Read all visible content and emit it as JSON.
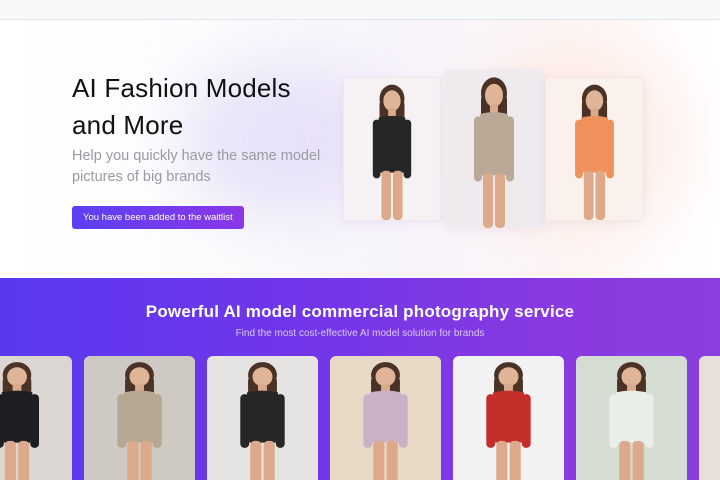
{
  "hero": {
    "title": "AI Fashion Models and More",
    "subtitle": "Help you quickly have the same model pictures of big brands",
    "waitlist_button": "You have been added to the waitlist"
  },
  "hero_images": [
    {
      "name": "model-black-bodysuit-image",
      "outfit_color": "#262626",
      "bg": "#f6f2f4"
    },
    {
      "name": "model-beige-henley-image",
      "outfit_color": "#b9a996",
      "bg": "#efeaee"
    },
    {
      "name": "model-orange-dress-image",
      "outfit_color": "#f0915c",
      "bg": "#faf1ec"
    }
  ],
  "services": {
    "title": "Powerful AI model commercial photography service",
    "subtitle": "Find the most cost-effective AI model solution for brands"
  },
  "gallery": [
    {
      "name": "gallery-black-lace-image",
      "outfit_color": "#1d1d22",
      "bg": "#dcd6d2"
    },
    {
      "name": "gallery-beige-henley-image",
      "outfit_color": "#b6a792",
      "bg": "#cfc9c4"
    },
    {
      "name": "gallery-black-bodysuit-image",
      "outfit_color": "#262626",
      "bg": "#e6e4e2"
    },
    {
      "name": "gallery-lilac-dress-image",
      "outfit_color": "#c9b2c8",
      "bg": "#e8d8c6"
    },
    {
      "name": "gallery-red-top-image",
      "outfit_color": "#c42f2b",
      "bg": "#f2f2f2"
    },
    {
      "name": "gallery-floral-dress-image",
      "outfit_color": "#e9eee6",
      "bg": "#d5ddd2"
    },
    {
      "name": "gallery-partial-image",
      "outfit_color": "#d9c9bd",
      "bg": "#e7e0da"
    }
  ],
  "colors": {
    "accent_start": "#5b3ff4",
    "accent_end": "#8a37e8",
    "band": "#6e36ea"
  }
}
